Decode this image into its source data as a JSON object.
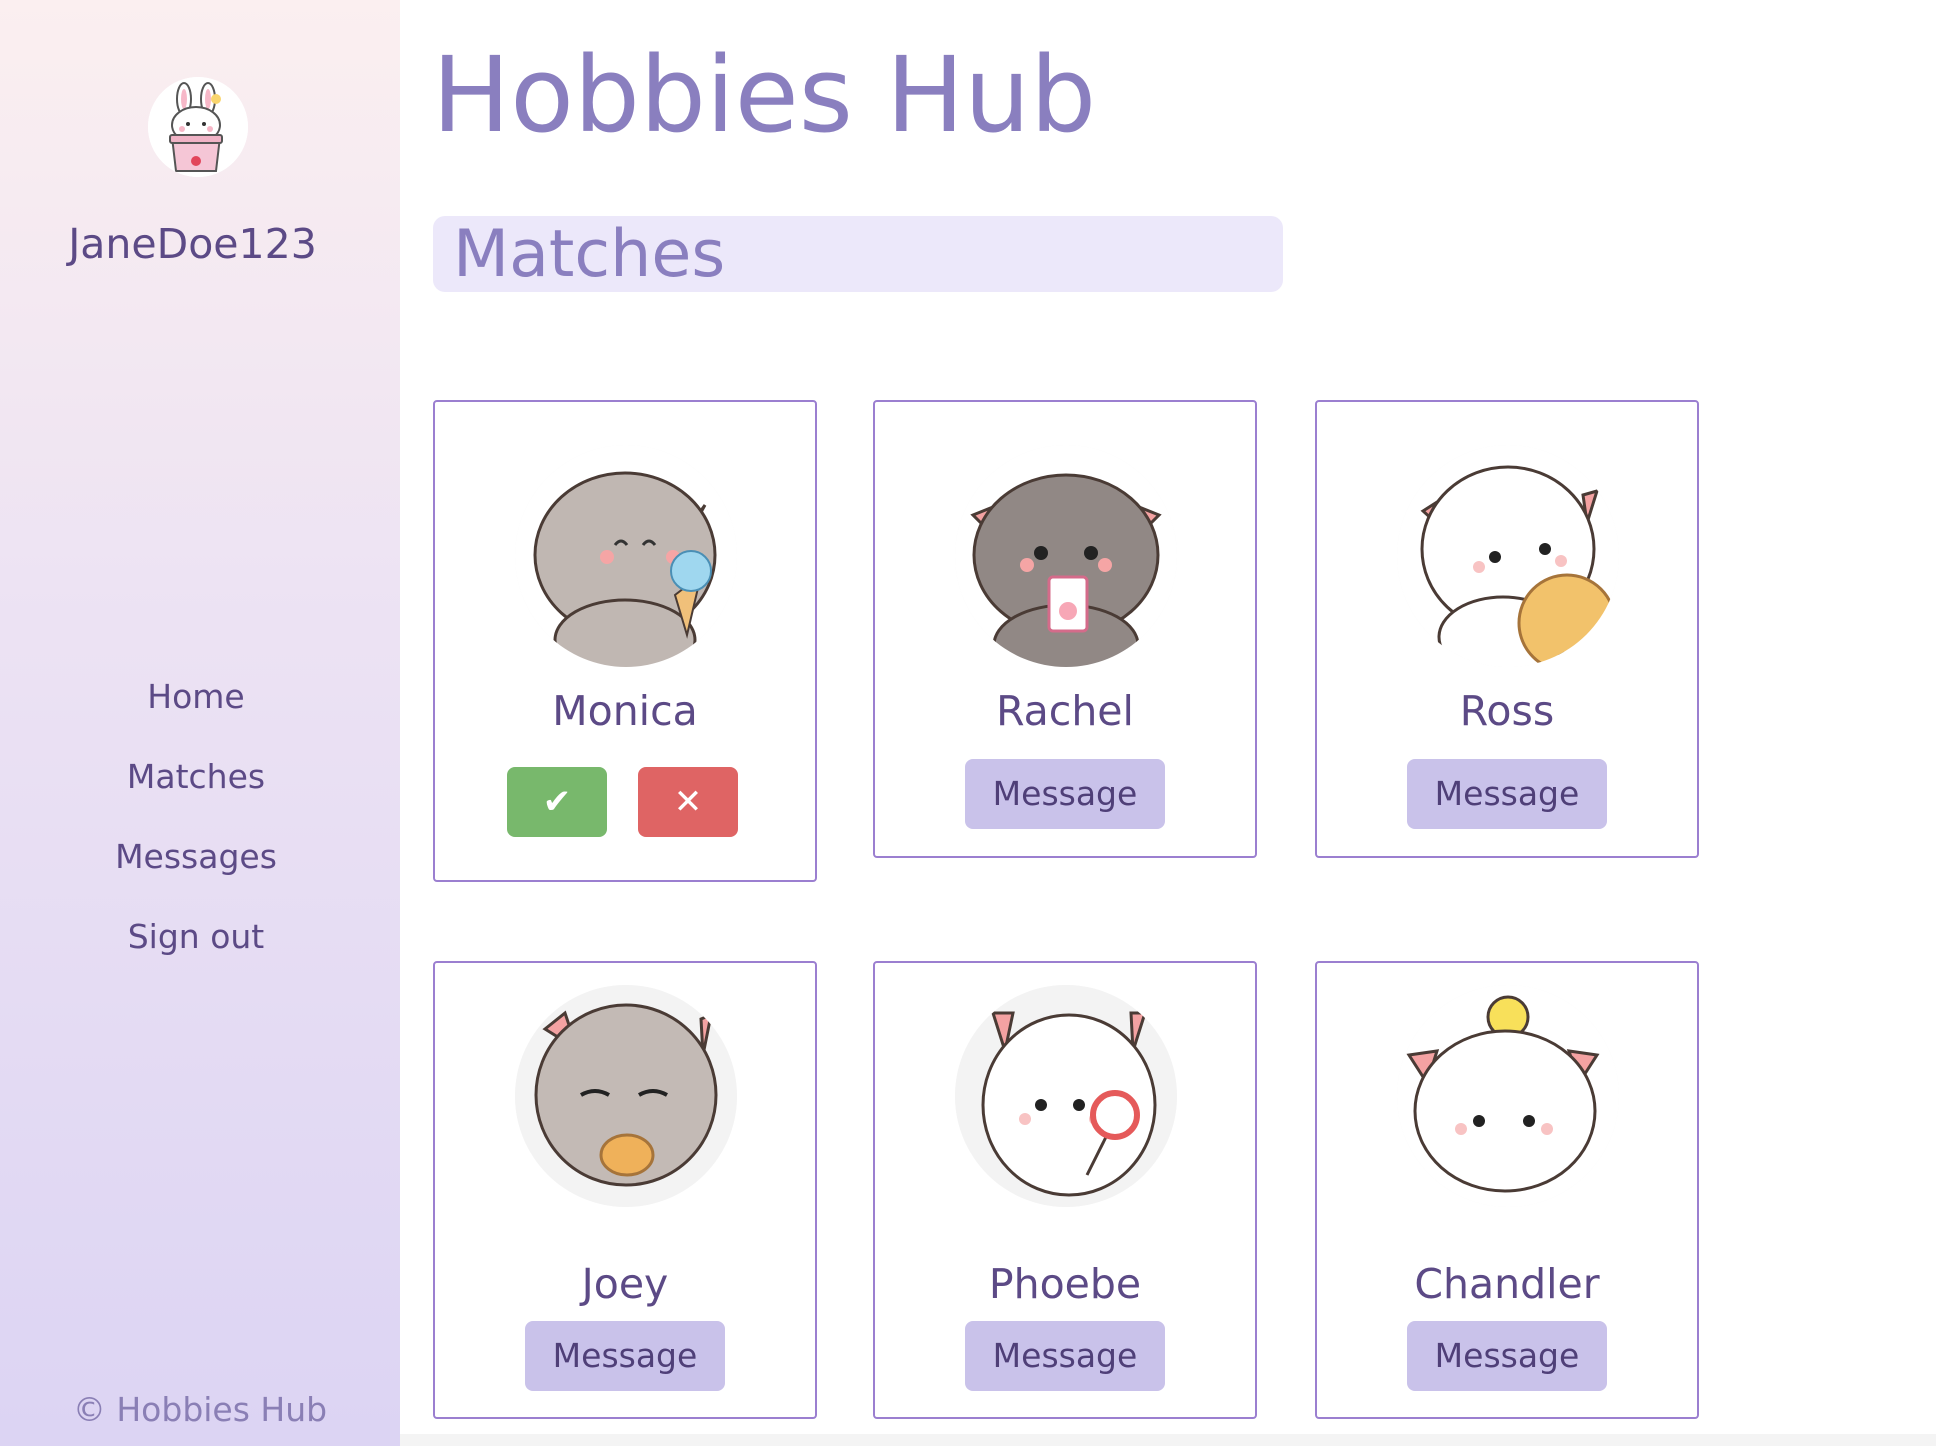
{
  "sidebar": {
    "username": "JaneDoe123",
    "nav": [
      "Home",
      "Matches",
      "Messages",
      "Sign out"
    ],
    "footer": "© Hobbies Hub"
  },
  "page": {
    "title": "Hobbies Hub",
    "section": "Matches"
  },
  "cards": [
    {
      "name": "Monica",
      "accept_label": "✔",
      "reject_label": "✕"
    },
    {
      "name": "Rachel",
      "button": "Message"
    },
    {
      "name": "Ross",
      "button": "Message"
    },
    {
      "name": "Joey",
      "button": "Message"
    },
    {
      "name": "Phoebe",
      "button": "Message"
    },
    {
      "name": "Chandler",
      "button": "Message"
    }
  ],
  "colors": {
    "accent": "#8a7fbf",
    "border": "#9b7fd0",
    "accept": "#78b86c",
    "reject": "#df6464",
    "message_button": "#c9c2ea"
  }
}
